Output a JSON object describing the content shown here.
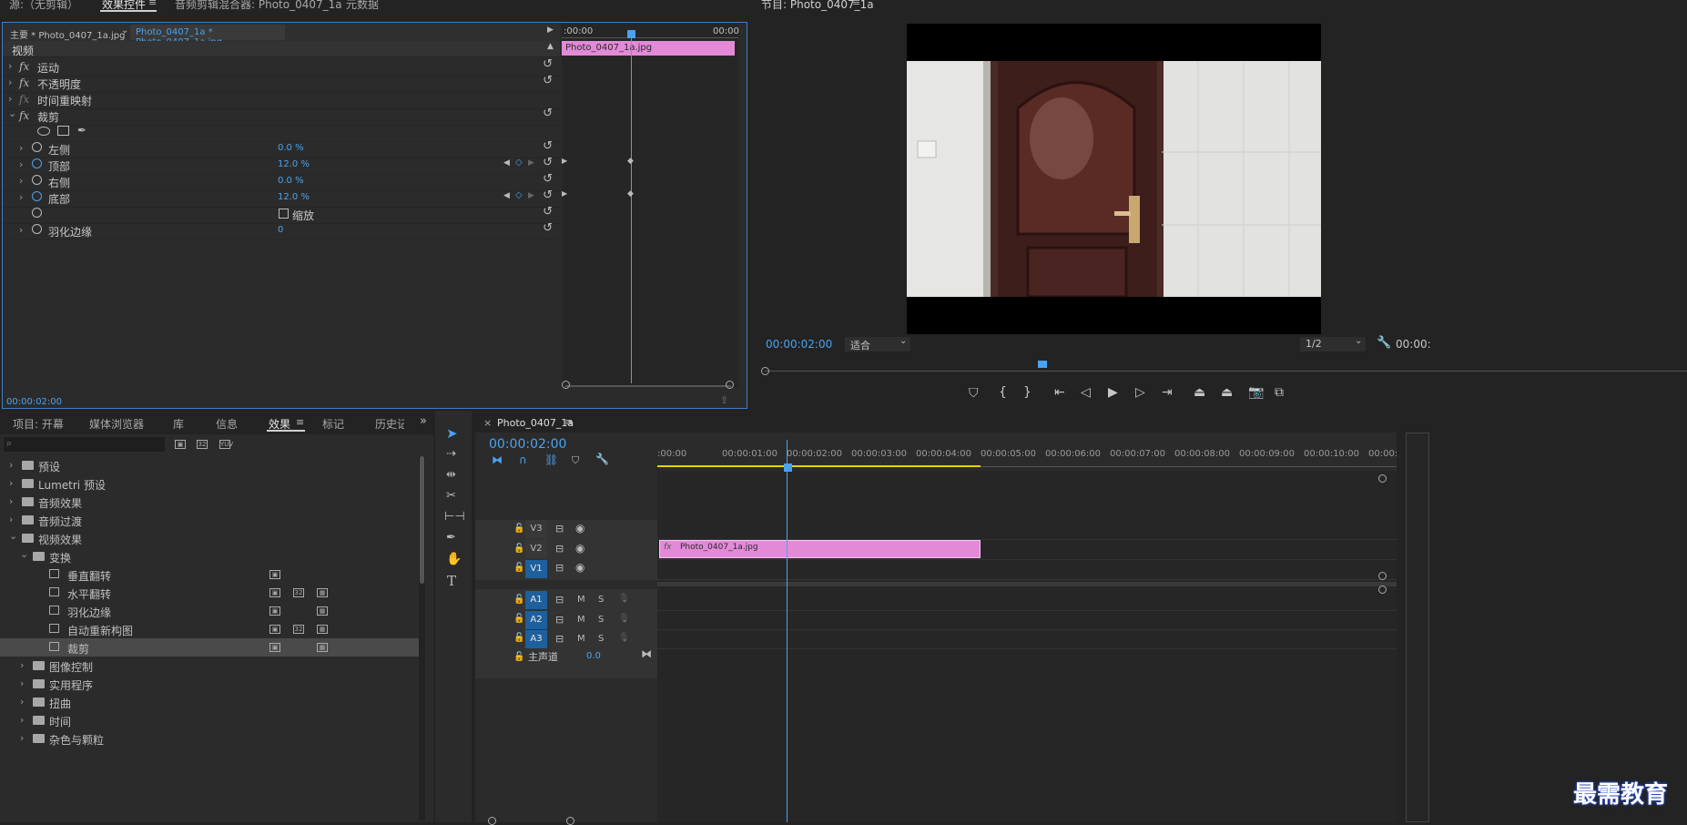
{
  "top_tabs": {
    "source": "源:（无剪辑）",
    "effect_controls": "效果控件",
    "audio_mixer": "音频剪辑混合器: Photo_0407_1a",
    "metadata": "元数据"
  },
  "effect_controls": {
    "master_clip": "主要 * Photo_0407_1a.jpg",
    "sequence_clip": "Photo_0407_1a * Photo_0407_1a.jpg",
    "mini_timeline_start": ":00:00",
    "mini_timeline_end": "00:00",
    "mini_clip_label": "Photo_0407_1a.jpg",
    "section_video": "视频",
    "effects": [
      {
        "name": "运动",
        "fx": "fx"
      },
      {
        "name": "不透明度",
        "fx": "fx"
      },
      {
        "name": "时间重映射",
        "fx": ""
      },
      {
        "name": "裁剪",
        "fx": "fx"
      }
    ],
    "crop_params": [
      {
        "label": "左侧",
        "value": "0.0 %"
      },
      {
        "label": "顶部",
        "value": "12.0 %"
      },
      {
        "label": "右侧",
        "value": "0.0 %"
      },
      {
        "label": "底部",
        "value": "12.0 %"
      }
    ],
    "zoom_label": "缩放",
    "feather_label": "羽化边缘",
    "feather_value": "0",
    "timecode": "00:00:02:00"
  },
  "program_monitor": {
    "title": "节目: Photo_0407_1a",
    "timecode": "00:00:02:00",
    "fit": "适合",
    "resolution": "1/2",
    "timecode_right": "00:00:"
  },
  "project_panel": {
    "tabs": [
      "项目: 开幕",
      "媒体浏览器",
      "库",
      "信息",
      "效果",
      "标记",
      "历史记"
    ],
    "active_tab": "效果",
    "tree": [
      {
        "label": "预设",
        "indent": 0,
        "type": "folder"
      },
      {
        "label": "Lumetri 预设",
        "indent": 0,
        "type": "folder"
      },
      {
        "label": "音频效果",
        "indent": 0,
        "type": "folder"
      },
      {
        "label": "音频过渡",
        "indent": 0,
        "type": "folder"
      },
      {
        "label": "视频效果",
        "indent": 0,
        "type": "folder",
        "open": true
      },
      {
        "label": "变换",
        "indent": 1,
        "type": "folder",
        "open": true
      },
      {
        "label": "垂直翻转",
        "indent": 2,
        "type": "effect"
      },
      {
        "label": "水平翻转",
        "indent": 2,
        "type": "effect"
      },
      {
        "label": "羽化边缘",
        "indent": 2,
        "type": "effect"
      },
      {
        "label": "自动重新构图",
        "indent": 2,
        "type": "effect"
      },
      {
        "label": "裁剪",
        "indent": 2,
        "type": "effect",
        "selected": true
      },
      {
        "label": "图像控制",
        "indent": 1,
        "type": "folder"
      },
      {
        "label": "实用程序",
        "indent": 1,
        "type": "folder"
      },
      {
        "label": "扭曲",
        "indent": 1,
        "type": "folder"
      },
      {
        "label": "时间",
        "indent": 1,
        "type": "folder"
      },
      {
        "label": "杂色与颗粒",
        "indent": 1,
        "type": "folder"
      }
    ]
  },
  "timeline": {
    "sequence_name": "Photo_0407_1a",
    "timecode": "00:00:02:00",
    "ruler": [
      ":00:00",
      "00:00:01:00",
      "00:00:02:00",
      "00:00:03:00",
      "00:00:04:00",
      "00:00:05:00",
      "00:00:06:00",
      "00:00:07:00",
      "00:00:08:00",
      "00:00:09:00",
      "00:00:10:00",
      "00:00:1"
    ],
    "video_tracks": [
      "V3",
      "V2",
      "V1"
    ],
    "audio_tracks": [
      "A1",
      "A2",
      "A3"
    ],
    "mute": "M",
    "solo": "S",
    "master": "主声道",
    "master_value": "0.0",
    "clip_label": "Photo_0407_1a.jpg"
  },
  "watermark": "最需教育",
  "colors": {
    "accent": "#4aa3f0",
    "clip_pink": "#e28ad8",
    "track_blue": "#1f5f9c"
  }
}
